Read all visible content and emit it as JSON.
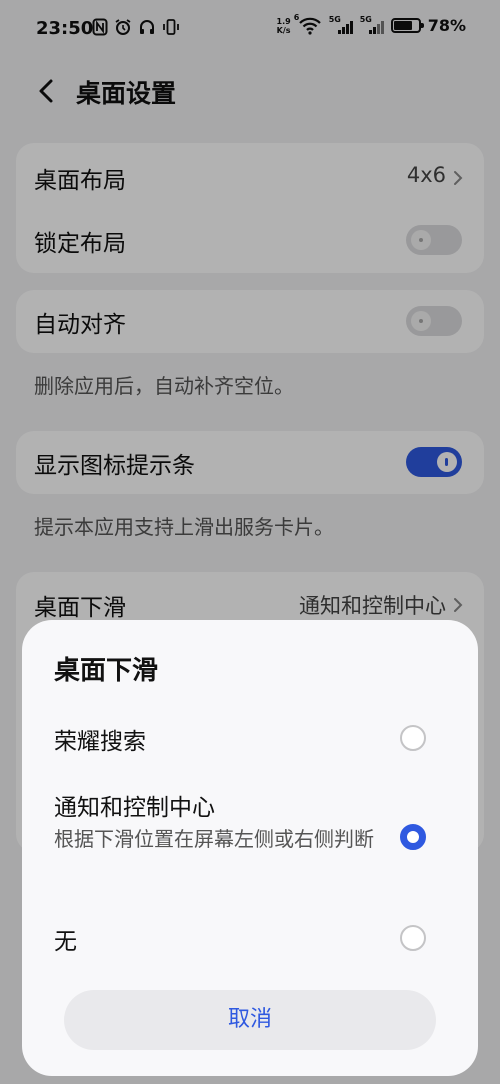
{
  "status_bar": {
    "time": "23:50",
    "net_speed_top": "1.9",
    "net_speed_bottom": "K/s",
    "wifi_badge": "6",
    "sim1_type": "5G",
    "sim2_type": "5G",
    "battery_percent": "78%",
    "battery_level": 0.78
  },
  "header": {
    "title": "桌面设置"
  },
  "settings": {
    "card1": {
      "layout_label": "桌面布局",
      "layout_value": "4x6",
      "lock_label": "锁定布局",
      "lock_on": false
    },
    "card2": {
      "auto_align_label": "自动对齐",
      "auto_align_on": false,
      "auto_align_desc": "删除应用后，自动补齐空位。"
    },
    "card3": {
      "icon_hint_label": "显示图标提示条",
      "icon_hint_on": true,
      "icon_hint_desc": "提示本应用支持上滑出服务卡片。"
    },
    "card4": {
      "swipe_label": "桌面下滑",
      "swipe_value": "通知和控制中心"
    }
  },
  "sheet": {
    "title": "桌面下滑",
    "options": [
      {
        "label": "荣耀搜索",
        "selected": false
      },
      {
        "label": "通知和控制中心",
        "sub": "根据下滑位置在屏幕左侧或右侧判断",
        "selected": true
      },
      {
        "label": "无",
        "selected": false
      }
    ],
    "cancel_label": "取消"
  },
  "colors": {
    "accent": "#2f59e0",
    "card_bg": "#ffffff",
    "page_bg": "#f1f1f3"
  }
}
